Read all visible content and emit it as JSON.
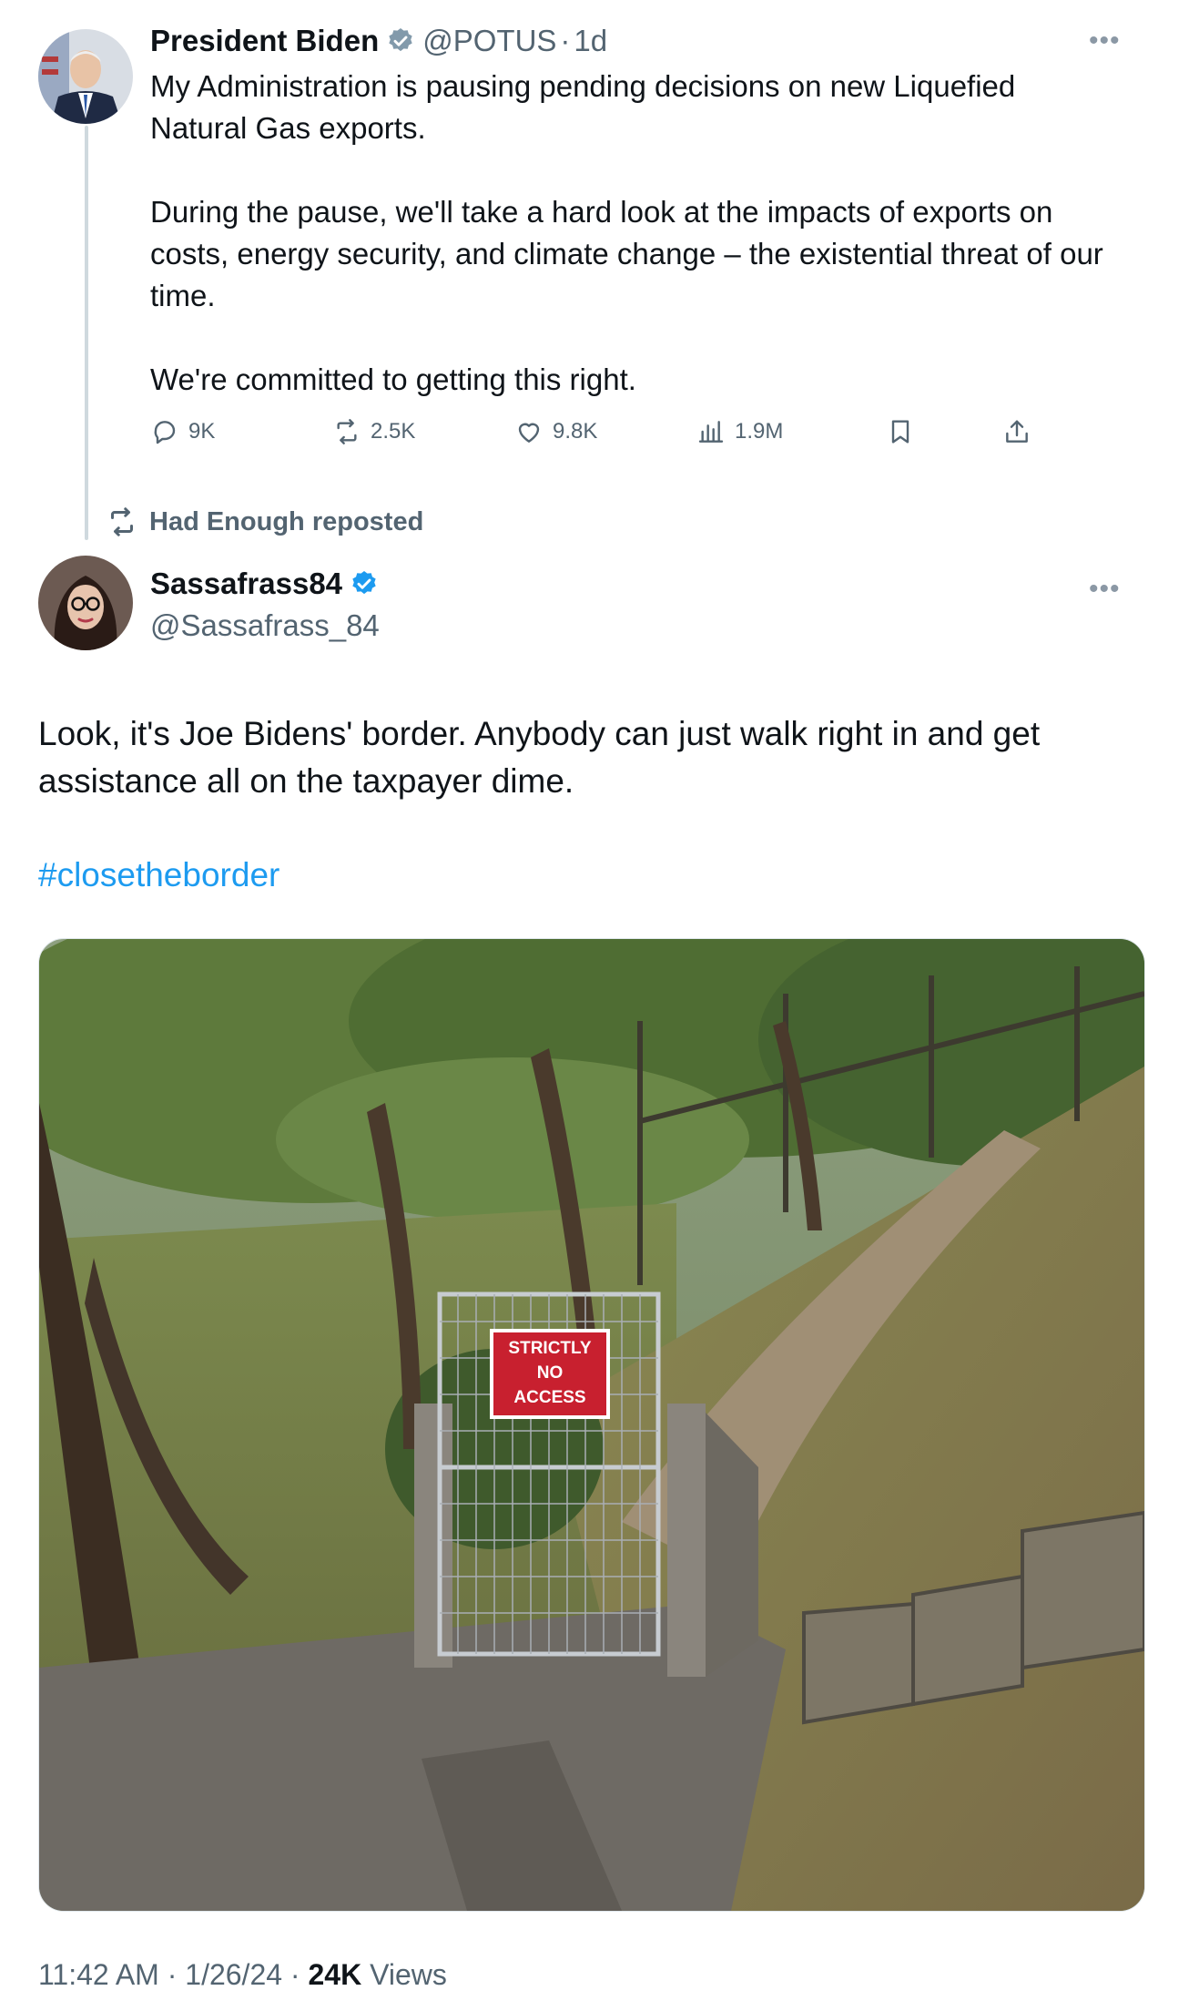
{
  "thread_tweet": {
    "display_name": "President Biden",
    "handle": "@POTUS",
    "separator": "·",
    "age": "1d",
    "text": "My Administration is pausing pending decisions on new Liquefied\nNatural Gas exports.\n\nDuring the pause, we'll take a hard look at the impacts of exports on\ncosts, energy security, and climate change – the existential threat of our\ntime.\n\nWe're committed to getting this right.",
    "actions": {
      "replies": "9K",
      "reposts": "2.5K",
      "likes": "9.8K",
      "views": "1.9M"
    },
    "verified_badge": "gray-check-badge-icon"
  },
  "repost_context": {
    "label": "Had Enough reposted"
  },
  "main_tweet": {
    "display_name": "Sassafrass84",
    "handle": "@Sassafrass_84",
    "verified_badge": "blue-check-badge-icon",
    "text": "Look, it's Joe Bidens' border. Anybody can just walk right in and get\nassistance all on the taxpayer dime.",
    "hashtag": "#closetheborder",
    "image_sign": [
      "STRICTLY",
      "NO",
      "ACCESS"
    ],
    "timestamp": "11:42 AM · 1/26/24 · ",
    "view_count": "24K",
    "view_label": " Views"
  },
  "colors": {
    "link_blue": "#1d9bf0",
    "secondary_text": "#536471",
    "verified_blue": "#1d9bf0",
    "sign_red": "#c8202f"
  }
}
